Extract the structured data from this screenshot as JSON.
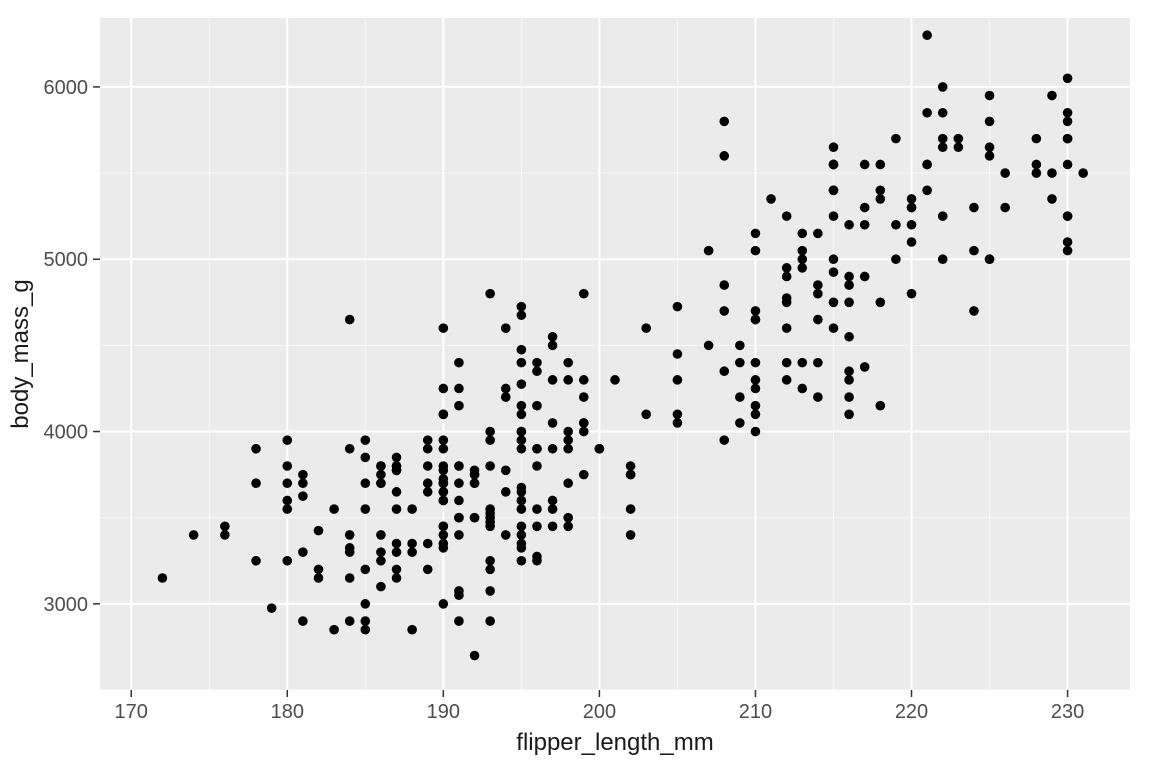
{
  "chart_data": {
    "type": "scatter",
    "xlabel": "flipper_length_mm",
    "ylabel": "body_mass_g",
    "xlim": [
      168,
      234
    ],
    "ylim": [
      2500,
      6400
    ],
    "x_ticks": [
      170,
      180,
      190,
      200,
      210,
      220,
      230
    ],
    "y_ticks": [
      3000,
      4000,
      5000,
      6000
    ],
    "x_minor": [
      175,
      185,
      195,
      205,
      215,
      225
    ],
    "y_minor": [
      2500,
      3500,
      4500,
      5500
    ],
    "points": [
      [
        181,
        3750
      ],
      [
        186,
        3800
      ],
      [
        195,
        3250
      ],
      [
        193,
        3450
      ],
      [
        190,
        3650
      ],
      [
        181,
        3625
      ],
      [
        195,
        4675
      ],
      [
        193,
        3475
      ],
      [
        190,
        4250
      ],
      [
        186,
        3300
      ],
      [
        180,
        3700
      ],
      [
        182,
        3200
      ],
      [
        191,
        3800
      ],
      [
        198,
        4400
      ],
      [
        185,
        3700
      ],
      [
        195,
        3450
      ],
      [
        197,
        4500
      ],
      [
        184,
        3325
      ],
      [
        194,
        4200
      ],
      [
        174,
        3400
      ],
      [
        180,
        3600
      ],
      [
        189,
        3800
      ],
      [
        185,
        3950
      ],
      [
        180,
        3800
      ],
      [
        187,
        3800
      ],
      [
        183,
        3550
      ],
      [
        187,
        3200
      ],
      [
        172,
        3150
      ],
      [
        180,
        3950
      ],
      [
        178,
        3250
      ],
      [
        178,
        3900
      ],
      [
        188,
        3300
      ],
      [
        184,
        3900
      ],
      [
        195,
        3325
      ],
      [
        196,
        4150
      ],
      [
        190,
        3950
      ],
      [
        180,
        3550
      ],
      [
        181,
        3300
      ],
      [
        184,
        4650
      ],
      [
        182,
        3150
      ],
      [
        195,
        3900
      ],
      [
        186,
        3100
      ],
      [
        196,
        4400
      ],
      [
        185,
        3000
      ],
      [
        190,
        4600
      ],
      [
        182,
        3425
      ],
      [
        179,
        2975
      ],
      [
        190,
        3450
      ],
      [
        191,
        3050
      ],
      [
        186,
        3700
      ],
      [
        188,
        3550
      ],
      [
        190,
        3800
      ],
      [
        200,
        3900
      ],
      [
        187,
        3300
      ],
      [
        191,
        4150
      ],
      [
        186,
        3400
      ],
      [
        193,
        3800
      ],
      [
        181,
        2900
      ],
      [
        194,
        4600
      ],
      [
        185,
        3200
      ],
      [
        195,
        4275
      ],
      [
        185,
        2900
      ],
      [
        192,
        3750
      ],
      [
        184,
        3150
      ],
      [
        192,
        3700
      ],
      [
        195,
        3550
      ],
      [
        188,
        2850
      ],
      [
        190,
        3000
      ],
      [
        198,
        4300
      ],
      [
        190,
        3700
      ],
      [
        190,
        3450
      ],
      [
        196,
        4350
      ],
      [
        197,
        3450
      ],
      [
        190,
        3725
      ],
      [
        195,
        4725
      ],
      [
        191,
        3075
      ],
      [
        184,
        2900
      ],
      [
        187,
        3550
      ],
      [
        195,
        3600
      ],
      [
        189,
        3350
      ],
      [
        196,
        3900
      ],
      [
        187,
        3850
      ],
      [
        193,
        4000
      ],
      [
        191,
        3400
      ],
      [
        194,
        3775
      ],
      [
        190,
        3325
      ],
      [
        189,
        3200
      ],
      [
        189,
        3900
      ],
      [
        190,
        4100
      ],
      [
        202,
        3750
      ],
      [
        205,
        4050
      ],
      [
        185,
        2850
      ],
      [
        186,
        3750
      ],
      [
        187,
        3150
      ],
      [
        208,
        4350
      ],
      [
        190,
        3600
      ],
      [
        196,
        3900
      ],
      [
        178,
        3700
      ],
      [
        192,
        3750
      ],
      [
        192,
        2700
      ],
      [
        203,
        4600
      ],
      [
        183,
        2850
      ],
      [
        190,
        3650
      ],
      [
        193,
        3950
      ],
      [
        184,
        3400
      ],
      [
        199,
        4200
      ],
      [
        190,
        3400
      ],
      [
        181,
        3700
      ],
      [
        197,
        4050
      ],
      [
        198,
        3700
      ],
      [
        191,
        4250
      ],
      [
        193,
        3550
      ],
      [
        197,
        3900
      ],
      [
        194,
        3650
      ],
      [
        176,
        3400
      ],
      [
        202,
        3750
      ],
      [
        186,
        3700
      ],
      [
        199,
        4000
      ],
      [
        191,
        4400
      ],
      [
        195,
        4150
      ],
      [
        191,
        3500
      ],
      [
        210,
        4400
      ],
      [
        190,
        3350
      ],
      [
        197,
        4300
      ],
      [
        193,
        3250
      ],
      [
        199,
        4050
      ],
      [
        187,
        3800
      ],
      [
        190,
        3600
      ],
      [
        196,
        3550
      ],
      [
        191,
        3500
      ],
      [
        195,
        3950
      ],
      [
        202,
        3550
      ],
      [
        205,
        4300
      ],
      [
        210,
        4100
      ],
      [
        205,
        4725
      ],
      [
        210,
        4250
      ],
      [
        211,
        5350
      ],
      [
        219,
        5700
      ],
      [
        209,
        4500
      ],
      [
        215,
        5550
      ],
      [
        214,
        4800
      ],
      [
        216,
        5200
      ],
      [
        214,
        4400
      ],
      [
        213,
        5150
      ],
      [
        210,
        4650
      ],
      [
        217,
        5550
      ],
      [
        210,
        4650
      ],
      [
        221,
        5850
      ],
      [
        209,
        4200
      ],
      [
        222,
        5850
      ],
      [
        218,
        4150
      ],
      [
        215,
        5550
      ],
      [
        213,
        4950
      ],
      [
        215,
        5400
      ],
      [
        215,
        4750
      ],
      [
        215,
        5650
      ],
      [
        216,
        4350
      ],
      [
        222,
        5700
      ],
      [
        209,
        4050
      ],
      [
        207,
        5050
      ],
      [
        230,
        5700
      ],
      [
        215,
        5000
      ],
      [
        220,
        5100
      ],
      [
        223,
        5650
      ],
      [
        212,
        4600
      ],
      [
        221,
        5550
      ],
      [
        212,
        5250
      ],
      [
        224,
        5050
      ],
      [
        212,
        4950
      ],
      [
        228,
        5700
      ],
      [
        218,
        5350
      ],
      [
        218,
        5550
      ],
      [
        212,
        4300
      ],
      [
        230,
        5700
      ],
      [
        218,
        4750
      ],
      [
        228,
        5550
      ],
      [
        212,
        4900
      ],
      [
        224,
        5300
      ],
      [
        214,
        4850
      ],
      [
        226,
        5300
      ],
      [
        216,
        4100
      ],
      [
        222,
        5000
      ],
      [
        203,
        4100
      ],
      [
        225,
        5000
      ],
      [
        219,
        5000
      ],
      [
        228,
        5500
      ],
      [
        215,
        4600
      ],
      [
        230,
        5550
      ],
      [
        220,
        5300
      ],
      [
        230,
        5100
      ],
      [
        222,
        5650
      ],
      [
        214,
        4650
      ],
      [
        219,
        5200
      ],
      [
        208,
        4850
      ],
      [
        225,
        5600
      ],
      [
        216,
        4550
      ],
      [
        230,
        5250
      ],
      [
        213,
        5000
      ],
      [
        230,
        5050
      ],
      [
        230,
        5800
      ],
      [
        208,
        3950
      ],
      [
        226,
        5500
      ],
      [
        216,
        4900
      ],
      [
        216,
        4750
      ],
      [
        221,
        5550
      ],
      [
        221,
        5400
      ],
      [
        217,
        5300
      ],
      [
        216,
        4300
      ],
      [
        230,
        5250
      ],
      [
        209,
        4400
      ],
      [
        220,
        5350
      ],
      [
        222,
        5250
      ],
      [
        221,
        6300
      ],
      [
        220,
        4800
      ],
      [
        207,
        4500
      ],
      [
        220,
        5200
      ],
      [
        208,
        4700
      ],
      [
        208,
        5800
      ],
      [
        224,
        4700
      ],
      [
        198,
        3450
      ],
      [
        208,
        5600
      ],
      [
        210,
        5050
      ],
      [
        231,
        5500
      ],
      [
        216,
        4850
      ],
      [
        225,
        5000
      ],
      [
        225,
        5950
      ],
      [
        194,
        3400
      ],
      [
        217,
        5200
      ],
      [
        195,
        4000
      ],
      [
        215,
        5400
      ],
      [
        210,
        5150
      ],
      [
        220,
        5300
      ],
      [
        210,
        4300
      ],
      [
        213,
        5050
      ],
      [
        205,
        4450
      ],
      [
        215,
        5550
      ],
      [
        216,
        4200
      ],
      [
        215,
        4925
      ],
      [
        214,
        4200
      ],
      [
        212,
        4775
      ],
      [
        213,
        4400
      ],
      [
        192,
        3500
      ],
      [
        212,
        4400
      ],
      [
        230,
        6050
      ],
      [
        214,
        5150
      ],
      [
        218,
        5400
      ],
      [
        215,
        5250
      ],
      [
        229,
        5350
      ],
      [
        223,
        5700
      ],
      [
        192,
        3500
      ],
      [
        225,
        5800
      ],
      [
        217,
        4900
      ],
      [
        212,
        4750
      ],
      [
        200,
        3900
      ],
      [
        229,
        5950
      ],
      [
        225,
        5650
      ],
      [
        229,
        5500
      ],
      [
        217,
        4375
      ],
      [
        230,
        5850
      ],
      [
        222,
        6000
      ],
      [
        195,
        4000
      ],
      [
        190,
        3775
      ],
      [
        198,
        3500
      ],
      [
        195,
        4475
      ],
      [
        210,
        4700
      ],
      [
        197,
        3600
      ],
      [
        196,
        3450
      ],
      [
        196,
        3250
      ],
      [
        199,
        4800
      ],
      [
        193,
        3525
      ],
      [
        189,
        3950
      ],
      [
        189,
        3650
      ],
      [
        187,
        3650
      ],
      [
        198,
        4000
      ],
      [
        176,
        3450
      ],
      [
        202,
        3400
      ],
      [
        186,
        3250
      ],
      [
        199,
        4050
      ],
      [
        191,
        3800
      ],
      [
        195,
        3350
      ],
      [
        191,
        3700
      ],
      [
        210,
        4150
      ],
      [
        190,
        3700
      ],
      [
        197,
        4550
      ],
      [
        193,
        3200
      ],
      [
        199,
        4300
      ],
      [
        187,
        3350
      ],
      [
        190,
        4100
      ],
      [
        191,
        3600
      ],
      [
        200,
        3900
      ],
      [
        185,
        3850
      ],
      [
        193,
        4800
      ],
      [
        193,
        2900
      ],
      [
        187,
        3775
      ],
      [
        188,
        3350
      ],
      [
        190,
        3900
      ],
      [
        192,
        3700
      ],
      [
        185,
        3550
      ],
      [
        190,
        3700
      ],
      [
        184,
        3300
      ],
      [
        195,
        4100
      ],
      [
        193,
        3500
      ],
      [
        187,
        3775
      ],
      [
        201,
        4300
      ],
      [
        180,
        3250
      ],
      [
        195,
        3675
      ],
      [
        195,
        3400
      ],
      [
        210,
        4000
      ],
      [
        192,
        3775
      ],
      [
        205,
        4100
      ],
      [
        186,
        3800
      ],
      [
        196,
        3275
      ],
      [
        193,
        3075
      ],
      [
        194,
        4250
      ],
      [
        195,
        4400
      ],
      [
        191,
        2900
      ],
      [
        197,
        3550
      ],
      [
        196,
        3800
      ],
      [
        199,
        3750
      ],
      [
        189,
        3700
      ],
      [
        198,
        3900
      ],
      [
        202,
        3800
      ],
      [
        195,
        3650
      ],
      [
        213,
        4250
      ],
      [
        198,
        3950
      ]
    ]
  }
}
